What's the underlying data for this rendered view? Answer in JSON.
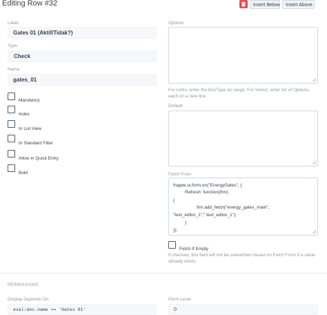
{
  "header": {
    "title": "Editing Row #32",
    "insert_below": "Insert Below",
    "insert_above": "Insert Above"
  },
  "left": {
    "label_caption": "Label",
    "label_value": "Gates 01 (Aktif/Tidak?)",
    "type_caption": "Type",
    "type_value": "Check",
    "name_caption": "Name",
    "name_value": "gates_01",
    "checkboxes": [
      "Mandatory",
      "Index",
      "In List View",
      "In Standard Filter",
      "Allow in Quick Entry",
      "Bold"
    ]
  },
  "right": {
    "options_caption": "Options",
    "options_help": "For Links, enter the DocType as range. For Select, enter list of Options, each on a new line.",
    "default_caption": "Default",
    "fetch_from_caption": "Fetch From",
    "fetch_code": [
      "frappe.ui.form.on(\"EnergyGates\", {",
      "Refresh: function(frm)",
      "{",
      "frm.add_fetch(\"energy_gates_main\",",
      "\"text_editor_1\",\" text_editor_1\");",
      "}",
      "});"
    ],
    "fetch_if_empty": "Fetch If Empty",
    "fetch_if_empty_help": "If checked, this field will not be overwritten based on Fetch From if a value already exists."
  },
  "permissions": {
    "section_title": "PERMISSIONS",
    "display_depends_caption": "Display Depends On",
    "display_depends_value": "eval:doc.name == 'Gates 01'",
    "perm_level_caption": "Perm Level",
    "perm_level_value": "0"
  },
  "colors": {
    "delete": "#e24c4c",
    "input_bg": "#f5f7fa",
    "muted": "#8d99a6",
    "text": "#36414c"
  }
}
